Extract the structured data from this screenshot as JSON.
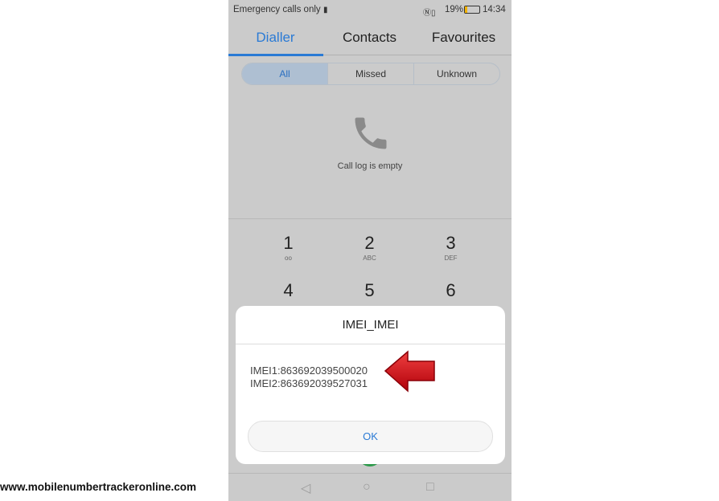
{
  "status_bar": {
    "carrier": "Emergency calls only",
    "battery_percent": "19%",
    "time": "14:34",
    "battery_level": 0.19
  },
  "tabs": [
    {
      "label": "Dialler",
      "active": true
    },
    {
      "label": "Contacts"
    },
    {
      "label": "Favourites"
    }
  ],
  "filters": [
    {
      "label": "All",
      "active": true
    },
    {
      "label": "Missed"
    },
    {
      "label": "Unknown"
    }
  ],
  "empty_state": {
    "icon": "phone-icon",
    "text": "Call log is empty"
  },
  "keypad": [
    {
      "digit": "1",
      "letters": "oo"
    },
    {
      "digit": "2",
      "letters": "ABC"
    },
    {
      "digit": "3",
      "letters": "DEF"
    },
    {
      "digit": "4",
      "letters": ""
    },
    {
      "digit": "5",
      "letters": ""
    },
    {
      "digit": "6",
      "letters": ""
    }
  ],
  "dialog": {
    "title": "IMEI_IMEI",
    "imei1": "IMEI1:863692039500020",
    "imei2": "IMEI2:863692039527031",
    "ok_label": "OK"
  },
  "colors": {
    "accent": "#2a7ad5",
    "arrow": "#d0121b"
  },
  "watermark": "www.mobilenumbertrackeronline.com"
}
